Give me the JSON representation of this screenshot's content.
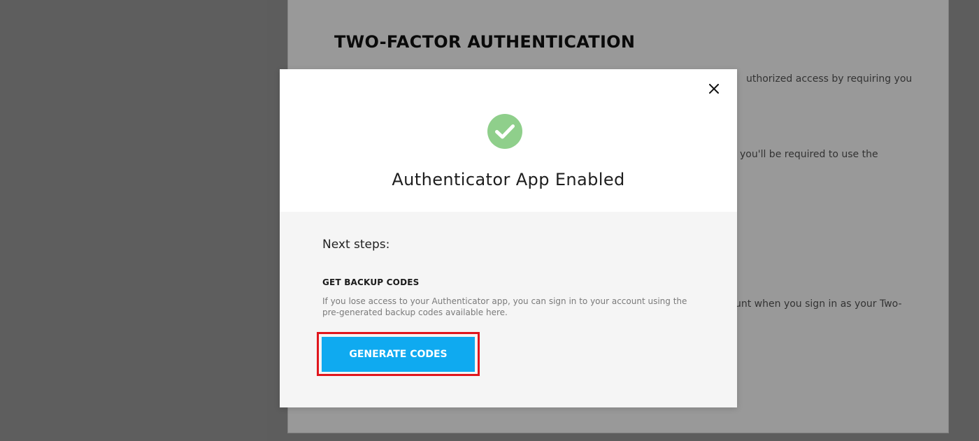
{
  "background": {
    "title": "TWO-FACTOR AUTHENTICATION",
    "text_fragments": [
      "uthorized access by requiring you",
      "you'll be required to use the",
      "unt when you sign in as your Two-"
    ]
  },
  "modal": {
    "title": "Authenticator App Enabled",
    "close_icon": "close-icon",
    "status_icon": "check-circle-icon",
    "next_steps_label": "Next steps:",
    "backup": {
      "heading": "GET BACKUP CODES",
      "description": "If you lose access to your Authenticator app, you can sign in to your account using the pre-generated backup codes available here.",
      "button_label": "GENERATE CODES"
    }
  },
  "colors": {
    "accent": "#0faaf0",
    "success": "#8fcf8b",
    "highlight": "#e0161d"
  }
}
